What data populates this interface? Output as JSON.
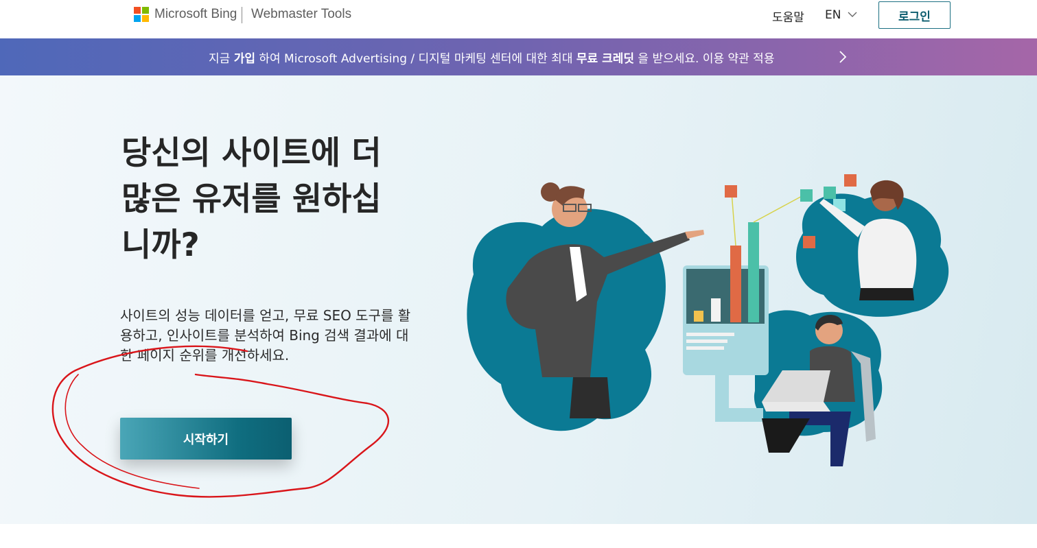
{
  "header": {
    "brand": "Microsoft Bing",
    "product": "Webmaster Tools",
    "help_label": "도움말",
    "language": "EN",
    "login_label": "로그인",
    "logo_colors": [
      "#f25022",
      "#7fba00",
      "#00a4ef",
      "#ffb900"
    ]
  },
  "banner": {
    "part1": "지금 ",
    "bold1": "가입",
    "part2": " 하여 Microsoft Advertising / 디지털 마케팅 센터에 대한 최대 ",
    "bold2": "무료 크레딧",
    "part3": " 을 받으세요. 이용 약관 적용"
  },
  "hero": {
    "title_line1": "당신의 사이트에 더",
    "title_line2": "많은 유저를 원하십",
    "title_line3": "니까?",
    "description_line1": "사이트의 성능 데이터를 얻고, 무료 SEO 도구를 활",
    "description_line2": "용하고, 인사이트를 분석하여 Bing 검색 결과에 대",
    "description_line3": "한 페이지 순위를 개선하세요.",
    "cta_label": "시작하기"
  },
  "colors": {
    "accent": "#0f6d7f",
    "annotation": "#d9151a"
  }
}
